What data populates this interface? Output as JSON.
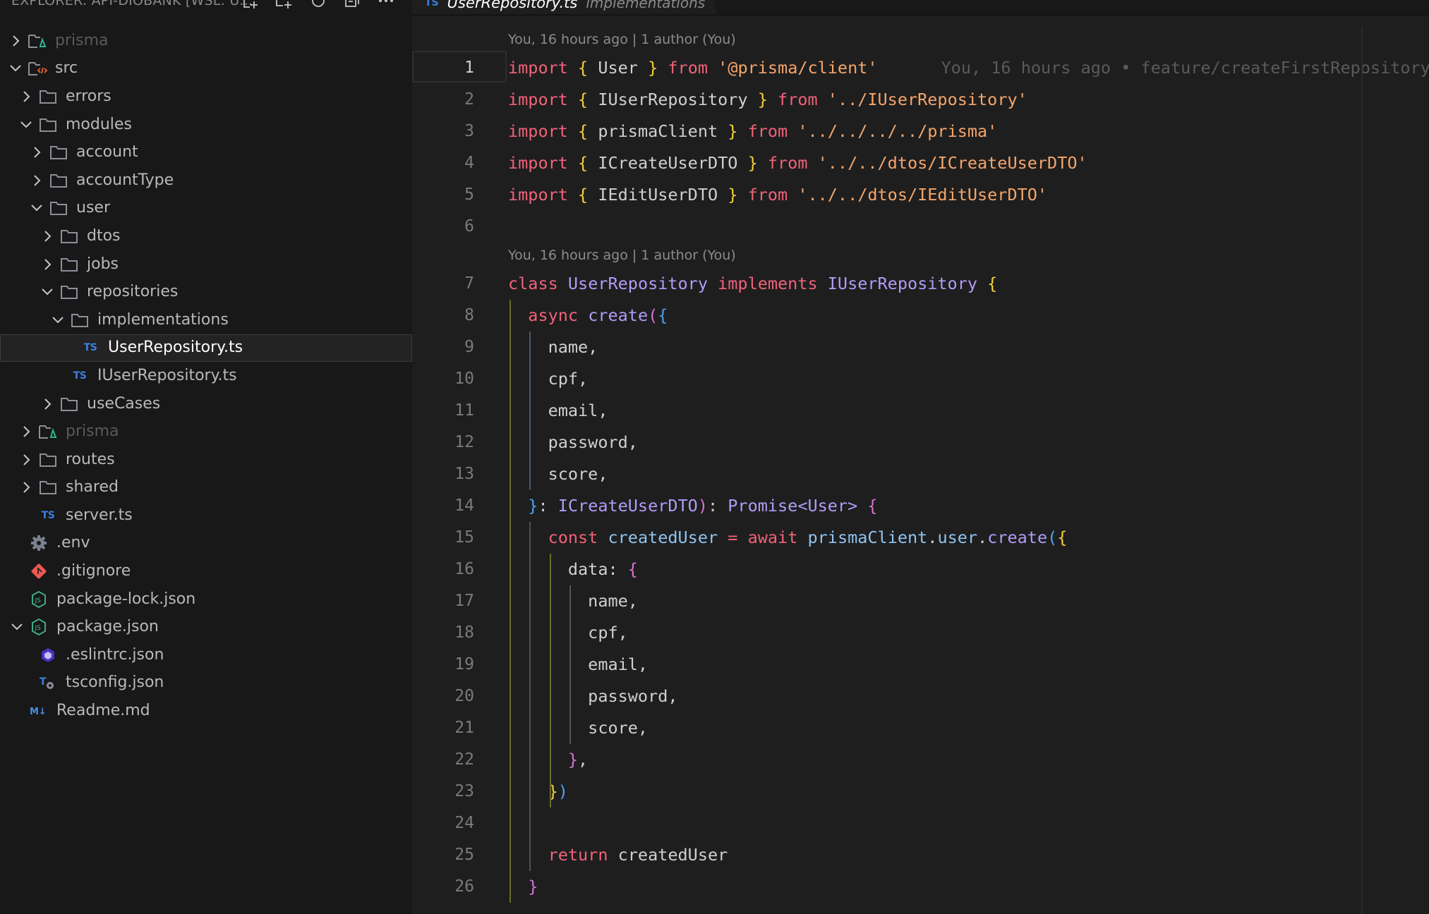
{
  "sidebar": {
    "title": "EXPLORER: API-DIOBANK [WSL: U...",
    "header_icons": [
      "new-file-icon",
      "new-folder-icon",
      "refresh-icon",
      "collapse-all-icon",
      "more-actions-icon"
    ],
    "items": [
      {
        "label": "prisma",
        "type": "folder-prisma",
        "depth": 0,
        "chevron": "right",
        "dim": true
      },
      {
        "label": "src",
        "type": "folder-src",
        "depth": 0,
        "chevron": "down"
      },
      {
        "label": "errors",
        "type": "folder",
        "depth": 1,
        "chevron": "right"
      },
      {
        "label": "modules",
        "type": "folder",
        "depth": 1,
        "chevron": "down"
      },
      {
        "label": "account",
        "type": "folder",
        "depth": 2,
        "chevron": "right"
      },
      {
        "label": "accountType",
        "type": "folder",
        "depth": 2,
        "chevron": "right"
      },
      {
        "label": "user",
        "type": "folder",
        "depth": 2,
        "chevron": "down"
      },
      {
        "label": "dtos",
        "type": "folder",
        "depth": 3,
        "chevron": "right"
      },
      {
        "label": "jobs",
        "type": "folder",
        "depth": 3,
        "chevron": "right"
      },
      {
        "label": "repositories",
        "type": "folder",
        "depth": 3,
        "chevron": "down"
      },
      {
        "label": "implementations",
        "type": "folder",
        "depth": 4,
        "chevron": "down"
      },
      {
        "label": "UserRepository.ts",
        "type": "ts",
        "depth": 5,
        "chevron": "none",
        "selected": true
      },
      {
        "label": "IUserRepository.ts",
        "type": "ts",
        "depth": 4,
        "chevron": "none"
      },
      {
        "label": "useCases",
        "type": "folder",
        "depth": 3,
        "chevron": "right"
      },
      {
        "label": "prisma",
        "type": "folder-prisma",
        "depth": 1,
        "chevron": "right",
        "dim": true
      },
      {
        "label": "routes",
        "type": "folder",
        "depth": 1,
        "chevron": "right"
      },
      {
        "label": "shared",
        "type": "folder",
        "depth": 1,
        "chevron": "right"
      },
      {
        "label": "server.ts",
        "type": "ts",
        "depth": 1,
        "chevron": "none"
      },
      {
        "label": ".env",
        "type": "env",
        "depth": 0,
        "chevron": "none"
      },
      {
        "label": ".gitignore",
        "type": "git",
        "depth": 0,
        "chevron": "none"
      },
      {
        "label": "package-lock.json",
        "type": "node",
        "depth": 0,
        "chevron": "none"
      },
      {
        "label": "package.json",
        "type": "node",
        "depth": 0,
        "chevron": "down"
      },
      {
        "label": ".eslintrc.json",
        "type": "eslint",
        "depth": 1,
        "chevron": "none"
      },
      {
        "label": "tsconfig.json",
        "type": "tsconfig",
        "depth": 1,
        "chevron": "none"
      },
      {
        "label": "Readme.md",
        "type": "markdown",
        "depth": 0,
        "chevron": "none"
      }
    ]
  },
  "tab": {
    "icon_text": "TS",
    "name": "UserRepository.ts",
    "description": "implementations",
    "close": "✕"
  },
  "editor": {
    "codelens_1": "You, 16 hours ago | 1 author (You)",
    "codelens_2": "You, 16 hours ago | 1 author (You)",
    "inline_blame": "You, 16 hours ago • feature/createFirstRepository",
    "current_line": 1,
    "lines": [
      {
        "n": "1",
        "tokens": [
          [
            "kw",
            "import"
          ],
          [
            "plain",
            " "
          ],
          [
            "br1",
            "{"
          ],
          [
            "plain",
            " User "
          ],
          [
            "br1",
            "}"
          ],
          [
            "plain",
            " "
          ],
          [
            "kw",
            "from"
          ],
          [
            "plain",
            " "
          ],
          [
            "str",
            "'@prisma/client'"
          ]
        ]
      },
      {
        "n": "2",
        "tokens": [
          [
            "kw",
            "import"
          ],
          [
            "plain",
            " "
          ],
          [
            "br1",
            "{"
          ],
          [
            "plain",
            " IUserRepository "
          ],
          [
            "br1",
            "}"
          ],
          [
            "plain",
            " "
          ],
          [
            "kw",
            "from"
          ],
          [
            "plain",
            " "
          ],
          [
            "str",
            "'../IUserRepository'"
          ]
        ]
      },
      {
        "n": "3",
        "tokens": [
          [
            "kw",
            "import"
          ],
          [
            "plain",
            " "
          ],
          [
            "br1",
            "{"
          ],
          [
            "plain",
            " prismaClient "
          ],
          [
            "br1",
            "}"
          ],
          [
            "plain",
            " "
          ],
          [
            "kw",
            "from"
          ],
          [
            "plain",
            " "
          ],
          [
            "str",
            "'../../../../prisma'"
          ]
        ]
      },
      {
        "n": "4",
        "tokens": [
          [
            "kw",
            "import"
          ],
          [
            "plain",
            " "
          ],
          [
            "br1",
            "{"
          ],
          [
            "plain",
            " ICreateUserDTO "
          ],
          [
            "br1",
            "}"
          ],
          [
            "plain",
            " "
          ],
          [
            "kw",
            "from"
          ],
          [
            "plain",
            " "
          ],
          [
            "str",
            "'../../dtos/ICreateUserDTO'"
          ]
        ]
      },
      {
        "n": "5",
        "tokens": [
          [
            "kw",
            "import"
          ],
          [
            "plain",
            " "
          ],
          [
            "br1",
            "{"
          ],
          [
            "plain",
            " IEditUserDTO "
          ],
          [
            "br1",
            "}"
          ],
          [
            "plain",
            " "
          ],
          [
            "kw",
            "from"
          ],
          [
            "plain",
            " "
          ],
          [
            "str",
            "'../../dtos/IEditUserDTO'"
          ]
        ]
      },
      {
        "n": "6",
        "tokens": []
      },
      {
        "n": "7",
        "tokens": [
          [
            "kw",
            "class"
          ],
          [
            "plain",
            " "
          ],
          [
            "cls",
            "UserRepository"
          ],
          [
            "plain",
            " "
          ],
          [
            "kw",
            "implements"
          ],
          [
            "plain",
            " "
          ],
          [
            "cls",
            "IUserRepository"
          ],
          [
            "plain",
            " "
          ],
          [
            "br1",
            "{"
          ]
        ]
      },
      {
        "n": "8",
        "tokens": [
          [
            "plain",
            "  "
          ],
          [
            "kw",
            "async"
          ],
          [
            "plain",
            " "
          ],
          [
            "fn",
            "create"
          ],
          [
            "br2",
            "("
          ],
          [
            "br3",
            "{"
          ]
        ]
      },
      {
        "n": "9",
        "tokens": [
          [
            "plain",
            "    name,"
          ]
        ]
      },
      {
        "n": "10",
        "tokens": [
          [
            "plain",
            "    cpf,"
          ]
        ]
      },
      {
        "n": "11",
        "tokens": [
          [
            "plain",
            "    email,"
          ]
        ]
      },
      {
        "n": "12",
        "tokens": [
          [
            "plain",
            "    password,"
          ]
        ]
      },
      {
        "n": "13",
        "tokens": [
          [
            "plain",
            "    score,"
          ]
        ]
      },
      {
        "n": "14",
        "tokens": [
          [
            "plain",
            "  "
          ],
          [
            "br3",
            "}"
          ],
          [
            "plain",
            ": "
          ],
          [
            "cls",
            "ICreateUserDTO"
          ],
          [
            "br2",
            ")"
          ],
          [
            "plain",
            ": "
          ],
          [
            "cls",
            "Promise<User>"
          ],
          [
            "plain",
            " "
          ],
          [
            "br2",
            "{"
          ]
        ]
      },
      {
        "n": "15",
        "tokens": [
          [
            "plain",
            "    "
          ],
          [
            "kw",
            "const"
          ],
          [
            "plain",
            " "
          ],
          [
            "var",
            "createdUser"
          ],
          [
            "plain",
            " "
          ],
          [
            "op",
            "="
          ],
          [
            "plain",
            " "
          ],
          [
            "kw",
            "await"
          ],
          [
            "plain",
            " "
          ],
          [
            "var",
            "prismaClient"
          ],
          [
            "plain",
            "."
          ],
          [
            "var",
            "user"
          ],
          [
            "plain",
            "."
          ],
          [
            "fn",
            "create"
          ],
          [
            "br3",
            "("
          ],
          [
            "br1",
            "{"
          ]
        ]
      },
      {
        "n": "16",
        "tokens": [
          [
            "plain",
            "      data: "
          ],
          [
            "br2",
            "{"
          ]
        ]
      },
      {
        "n": "17",
        "tokens": [
          [
            "plain",
            "        name,"
          ]
        ]
      },
      {
        "n": "18",
        "tokens": [
          [
            "plain",
            "        cpf,"
          ]
        ]
      },
      {
        "n": "19",
        "tokens": [
          [
            "plain",
            "        email,"
          ]
        ]
      },
      {
        "n": "20",
        "tokens": [
          [
            "plain",
            "        password,"
          ]
        ]
      },
      {
        "n": "21",
        "tokens": [
          [
            "plain",
            "        score,"
          ]
        ]
      },
      {
        "n": "22",
        "tokens": [
          [
            "plain",
            "      "
          ],
          [
            "br2",
            "}"
          ],
          [
            "plain",
            ","
          ]
        ]
      },
      {
        "n": "23",
        "tokens": [
          [
            "plain",
            "    "
          ],
          [
            "br1",
            "}"
          ],
          [
            "br3",
            ")"
          ]
        ]
      },
      {
        "n": "24",
        "tokens": []
      },
      {
        "n": "25",
        "tokens": [
          [
            "plain",
            "    "
          ],
          [
            "kw",
            "return"
          ],
          [
            "plain",
            " createdUser"
          ]
        ]
      },
      {
        "n": "26",
        "tokens": [
          [
            "plain",
            "  "
          ],
          [
            "br2",
            "}"
          ]
        ]
      }
    ]
  },
  "colors": {
    "keyword": "#f2627a",
    "string": "#f5a56b",
    "class": "#b09cf7",
    "bracket_1": "#f5d03b",
    "bracket_2": "#d672d6",
    "bracket_3": "#4ba3f0",
    "ts_icon": "#3a7fe0"
  }
}
